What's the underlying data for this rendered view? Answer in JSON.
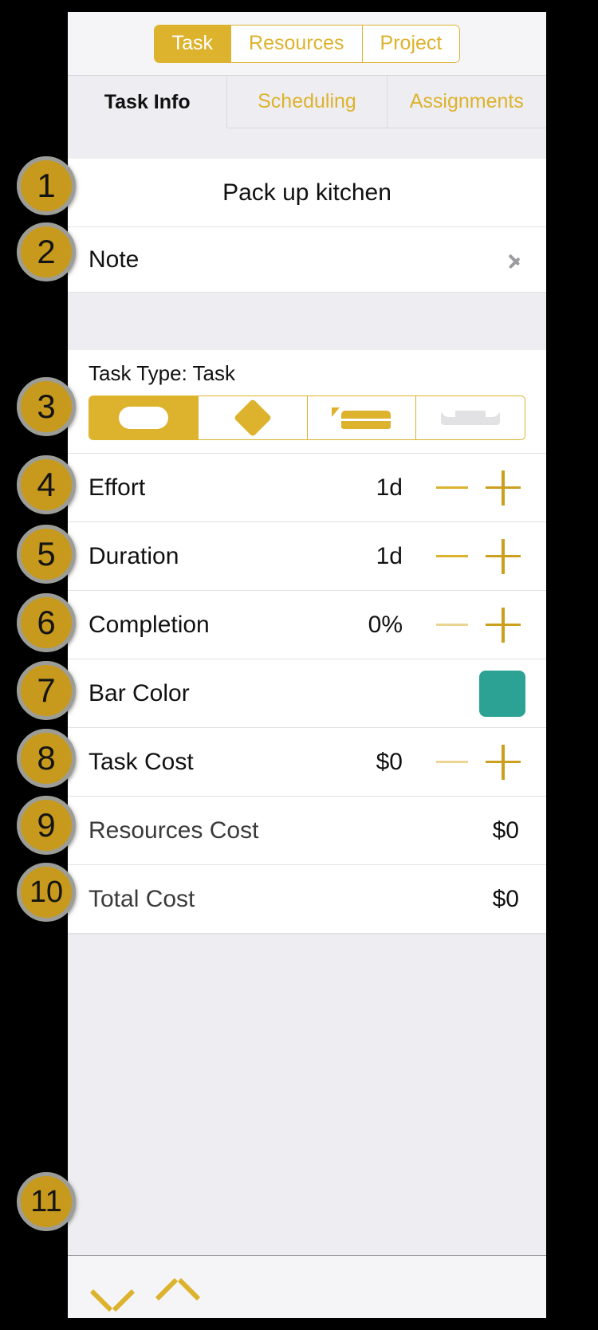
{
  "app": {
    "accent_color": "#ddb22c",
    "bar_color_swatch": "#2ba294",
    "badge_color": "#c79a1d"
  },
  "top_segmented": {
    "items": [
      {
        "label": "Task",
        "active": true
      },
      {
        "label": "Resources",
        "active": false
      },
      {
        "label": "Project",
        "active": false
      }
    ]
  },
  "tabs": {
    "items": [
      {
        "label": "Task Info",
        "active": true
      },
      {
        "label": "Scheduling",
        "active": false
      },
      {
        "label": "Assignments",
        "active": false
      }
    ]
  },
  "task": {
    "title": "Pack up kitchen",
    "note_label": "Note",
    "task_type_label": "Task Type: Task",
    "type_options": [
      {
        "name": "task",
        "active": true
      },
      {
        "name": "milestone",
        "active": false
      },
      {
        "name": "group",
        "active": false
      },
      {
        "name": "hammock",
        "active": false
      }
    ],
    "rows": [
      {
        "label": "Effort",
        "value": "1d"
      },
      {
        "label": "Duration",
        "value": "1d"
      },
      {
        "label": "Completion",
        "value": "0%"
      },
      {
        "label": "Bar Color",
        "value": ""
      },
      {
        "label": "Task Cost",
        "value": "$0"
      },
      {
        "label": "Resources Cost",
        "value": "$0"
      },
      {
        "label": "Total Cost",
        "value": "$0"
      }
    ]
  },
  "bottom_toolbar": {
    "prev_label": "chevron-down",
    "next_label": "chevron-up"
  },
  "annotations": {
    "badges": [
      {
        "n": "1"
      },
      {
        "n": "2"
      },
      {
        "n": "3"
      },
      {
        "n": "4"
      },
      {
        "n": "5"
      },
      {
        "n": "6"
      },
      {
        "n": "7"
      },
      {
        "n": "8"
      },
      {
        "n": "9"
      },
      {
        "n": "10"
      },
      {
        "n": "11"
      }
    ]
  }
}
